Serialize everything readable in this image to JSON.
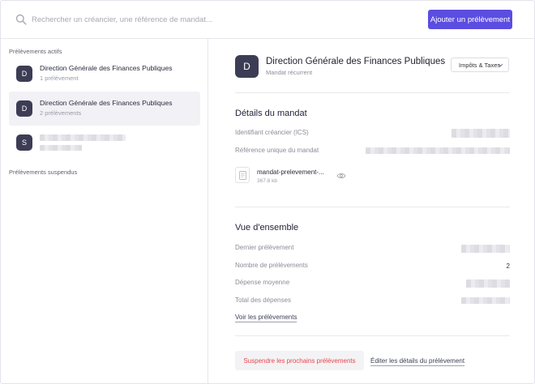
{
  "topbar": {
    "search_placeholder": "Rechercher un créancier, une référence de mandat...",
    "add_button_label": "Ajouter un prélèvement"
  },
  "sidebar": {
    "active_title": "Prélèvements actifs",
    "suspended_title": "Prélèvements suspendus",
    "items": [
      {
        "initial": "D",
        "title": "Direction Générale des Finances Publiques",
        "subtitle": "1 prélèvement",
        "selected": false
      },
      {
        "initial": "D",
        "title": "Direction Générale des Finances Publiques",
        "subtitle": "2 prélèvements",
        "selected": true
      },
      {
        "initial": "S",
        "title": "",
        "subtitle": "",
        "selected": false
      }
    ]
  },
  "main": {
    "avatar_initial": "D",
    "title": "Direction Générale des Finances Publiques",
    "subtitle": "Mandat récurrent",
    "category": "Impôts & Taxes",
    "mandate_details": {
      "heading": "Détails du mandat",
      "creditor_id_label": "Identifiant créancier (ICS)",
      "reference_label": "Référence unique du mandat",
      "file_name": "mandat-prelevement-...",
      "file_size": "367.8 kb"
    },
    "overview": {
      "heading": "Vue d'ensemble",
      "last_debit_label": "Dernier prélèvement",
      "count_label": "Nombre de prélèvements",
      "count_value": "2",
      "average_label": "Dépense moyenne",
      "total_label": "Total des dépenses",
      "see_link": "Voir les prélèvements"
    },
    "actions": {
      "suspend_label": "Suspendre les prochains prélèvements",
      "edit_label": "Éditer les détails du prélèvement"
    }
  },
  "colors": {
    "accent": "#5b4de0",
    "avatar": "#3c3d55",
    "danger": "#e5484d"
  }
}
